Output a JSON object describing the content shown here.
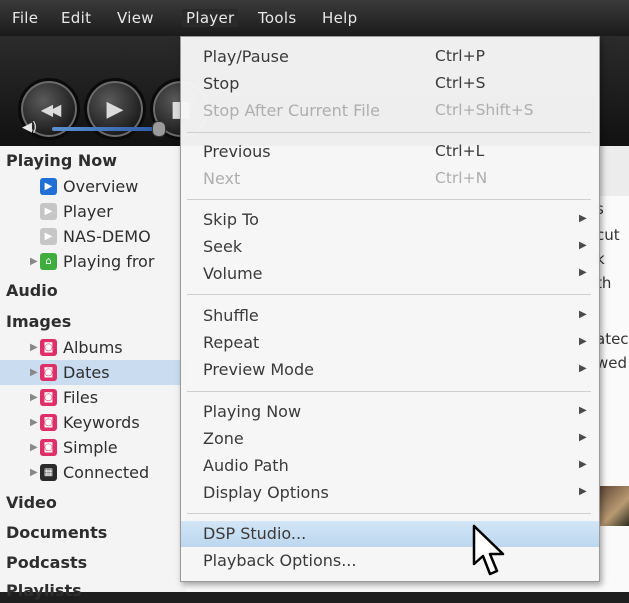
{
  "menubar": {
    "file": "File",
    "edit": "Edit",
    "view": "View",
    "player": "Player",
    "tools": "Tools",
    "help": "Help"
  },
  "transport": {
    "previous_glyph": "◀◀",
    "play_glyph": "▶",
    "stop_glyph": "■",
    "volume_glyph": "◀)"
  },
  "sidebar": {
    "playing_now": "Playing Now",
    "overview": "Overview",
    "player": "Player",
    "nas_demo": "NAS-DEMO",
    "playing_from": "Playing fror",
    "audio": "Audio",
    "images": "Images",
    "albums": "Albums",
    "dates": "Dates",
    "files": "Files",
    "keywords": "Keywords",
    "simple": "Simple",
    "connected": "Connected",
    "video": "Video",
    "documents": "Documents",
    "podcasts": "Podcasts",
    "playlists": "Playlists"
  },
  "content_fragments": {
    "f1": "s",
    "f2": "cut",
    "f3": "k",
    "f4": "th",
    "f5": "atec",
    "f6": "wed"
  },
  "player_menu": {
    "play_pause": {
      "label": "Play/Pause",
      "shortcut": "Ctrl+P"
    },
    "stop": {
      "label": "Stop",
      "shortcut": "Ctrl+S"
    },
    "stop_after": {
      "label": "Stop After Current File",
      "shortcut": "Ctrl+Shift+S"
    },
    "previous": {
      "label": "Previous",
      "shortcut": "Ctrl+L"
    },
    "next": {
      "label": "Next",
      "shortcut": "Ctrl+N"
    },
    "skip_to": {
      "label": "Skip To"
    },
    "seek": {
      "label": "Seek"
    },
    "volume": {
      "label": "Volume"
    },
    "shuffle": {
      "label": "Shuffle"
    },
    "repeat": {
      "label": "Repeat"
    },
    "preview_mode": {
      "label": "Preview Mode"
    },
    "playing_now": {
      "label": "Playing Now"
    },
    "zone": {
      "label": "Zone"
    },
    "audio_path": {
      "label": "Audio Path"
    },
    "display_options": {
      "label": "Display Options"
    },
    "dsp_studio": {
      "label": "DSP Studio..."
    },
    "playback_options": {
      "label": "Playback Options..."
    },
    "submenu_glyph": "▶"
  },
  "colors": {
    "highlight": "#c9dcf0",
    "menu_bg": "#f6f6f6",
    "disabled_text": "#aeaeae",
    "chrome": "#1b1b1b"
  }
}
